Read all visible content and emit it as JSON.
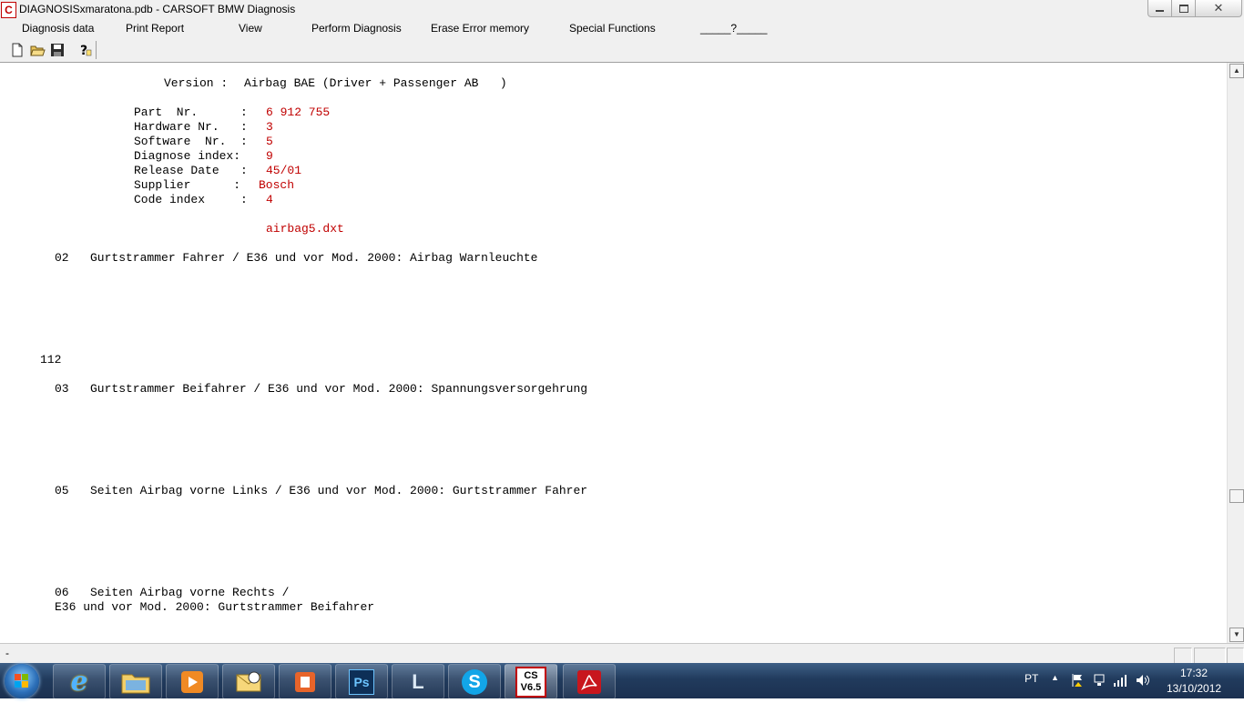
{
  "window": {
    "title": "DIAGNOSISxmaratona.pdb - CARSOFT BMW Diagnosis",
    "app_icon_letter": "C",
    "close_glyph": "✕"
  },
  "menu": [
    "Diagnosis data",
    "Print Report",
    "View",
    "Perform Diagnosis",
    "Erase Error memory",
    "Special Functions",
    "_____?_____"
  ],
  "toolbar_icons": [
    "new-document-icon",
    "open-folder-icon",
    "save-disk-icon",
    "help-icon"
  ],
  "report": {
    "version_label": "Version :",
    "version_value": "Airbag BAE (Driver + Passenger AB   )",
    "fields": [
      {
        "label": "Part  Nr.      :",
        "value": "6 912 755"
      },
      {
        "label": "Hardware Nr.   :",
        "value": "3"
      },
      {
        "label": "Software  Nr.  :",
        "value": "5"
      },
      {
        "label": "Diagnose index:",
        "value": "9"
      },
      {
        "label": "Release Date   :",
        "value": "45/01"
      },
      {
        "label": "Supplier      :",
        "value": "Bosch"
      },
      {
        "label": "Code index     :",
        "value": "4"
      }
    ],
    "file": "airbag5.dxt",
    "faults": [
      {
        "code": "02",
        "text": "Gurtstrammer Fahrer / E36 und vor Mod. 2000: Airbag Warnleuchte"
      },
      {
        "code": "03",
        "text": "Gurtstrammer Beifahrer / E36 und vor Mod. 2000: Spannungsversorgehrung"
      },
      {
        "code": "05",
        "text": "Seiten Airbag vorne Links / E36 und vor Mod. 2000: Gurtstrammer Fahrer"
      },
      {
        "code": "06",
        "text": "Seiten Airbag vorne Rechts /",
        "text2": "E36 und vor Mod. 2000: Gurtstrammer Beifahrer"
      }
    ],
    "count": "112"
  },
  "status": {
    "text": "-"
  },
  "taskbar": {
    "apps": [
      {
        "name": "internet-explorer",
        "label": "e"
      },
      {
        "name": "file-explorer",
        "label": ""
      },
      {
        "name": "media-player",
        "label": ""
      },
      {
        "name": "outlook",
        "label": ""
      },
      {
        "name": "office",
        "label": ""
      },
      {
        "name": "photoshop",
        "label": "Ps"
      },
      {
        "name": "app-l",
        "label": "L"
      },
      {
        "name": "skype",
        "label": "S"
      },
      {
        "name": "carsoft",
        "label_line1": "CS",
        "label_line2": "V6.5"
      },
      {
        "name": "acrobat",
        "label": ""
      }
    ],
    "language": "PT",
    "time": "17:32",
    "date": "13/10/2012"
  },
  "colors": {
    "report_red": "#c00000",
    "taskbar": "#213b5d"
  }
}
